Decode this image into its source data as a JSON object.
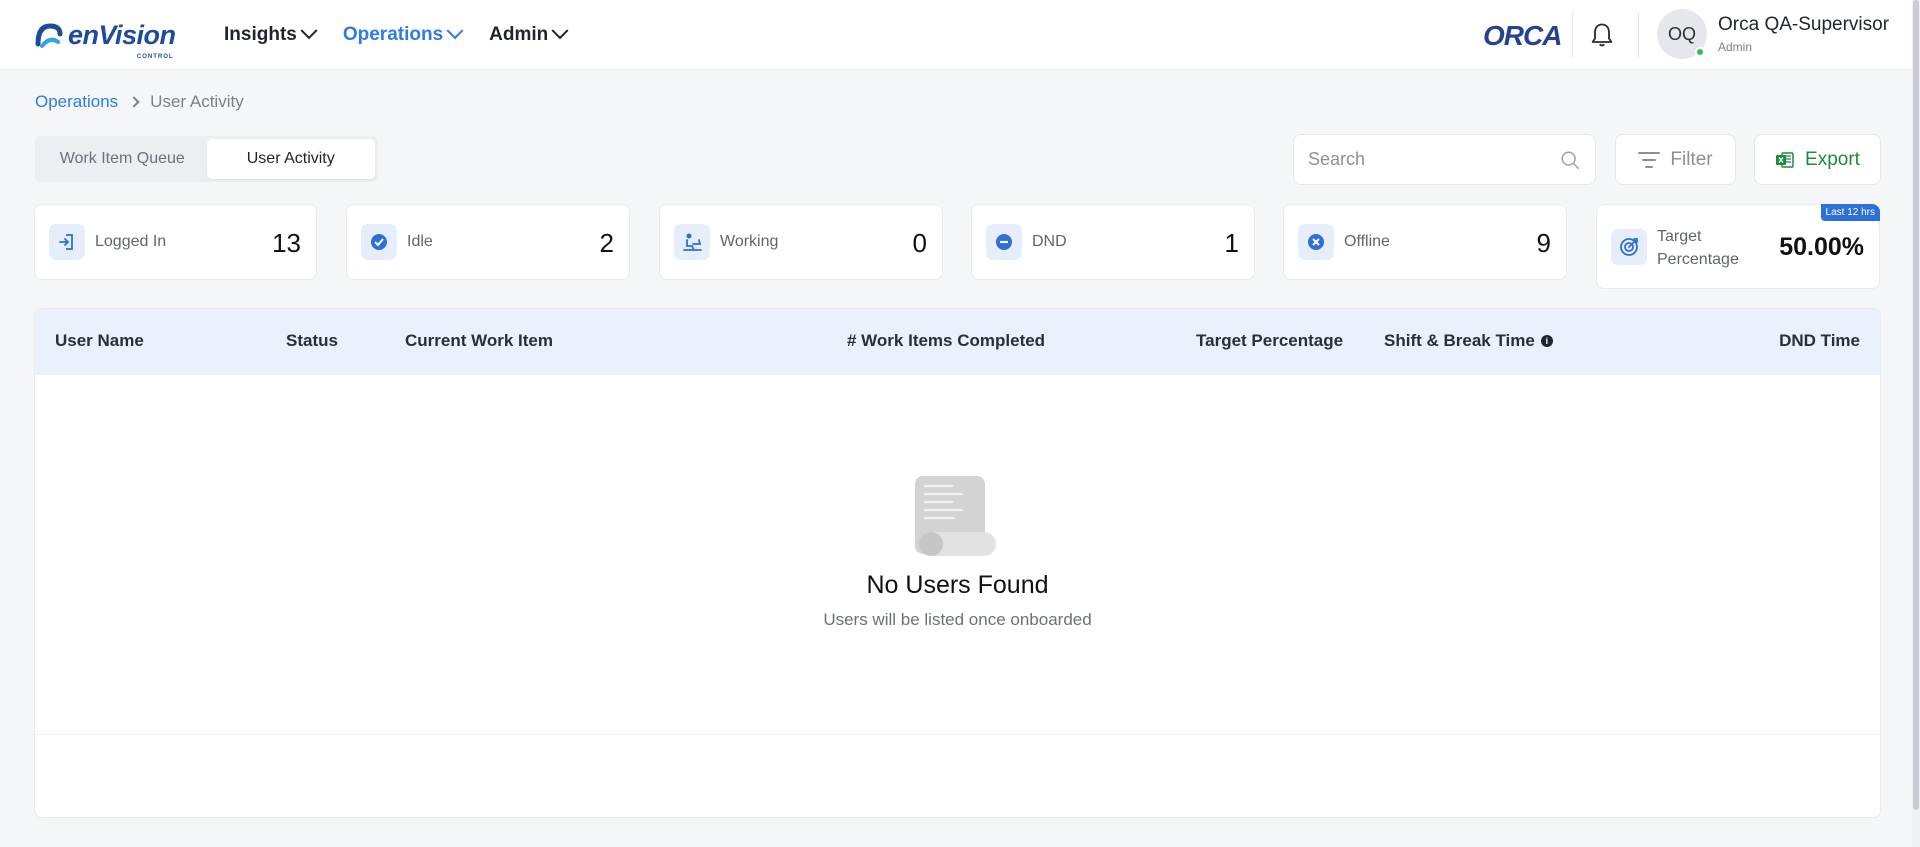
{
  "header": {
    "logo_text": "enVision",
    "logo_sub": "CONTROL",
    "nav": [
      {
        "label": "Insights",
        "active": false
      },
      {
        "label": "Operations",
        "active": true
      },
      {
        "label": "Admin",
        "active": false
      }
    ],
    "brand_right": "ORCA",
    "user": {
      "initials": "OQ",
      "name": "Orca QA-Supervisor",
      "role": "Admin",
      "online": true
    }
  },
  "breadcrumb": {
    "parent": "Operations",
    "current": "User Activity"
  },
  "tabs": [
    {
      "label": "Work Item Queue",
      "active": false
    },
    {
      "label": "User Activity",
      "active": true
    }
  ],
  "toolbar": {
    "search_placeholder": "Search",
    "filter_label": "Filter",
    "export_label": "Export"
  },
  "stats": [
    {
      "label": "Logged In",
      "value": "13",
      "icon": "login-icon"
    },
    {
      "label": "Idle",
      "value": "2",
      "icon": "check-circle-icon"
    },
    {
      "label": "Working",
      "value": "0",
      "icon": "working-icon"
    },
    {
      "label": "DND",
      "value": "1",
      "icon": "minus-circle-icon"
    },
    {
      "label": "Offline",
      "value": "9",
      "icon": "x-circle-icon"
    }
  ],
  "target": {
    "label": "Target Percentage",
    "value": "50.00%",
    "badge": "Last 12 hrs",
    "icon": "target-icon"
  },
  "table": {
    "columns": [
      "User Name",
      "Status",
      "Current Work Item",
      "# Work Items Completed",
      "Target Percentage",
      "Shift & Break Time",
      "DND Time"
    ],
    "info_glyph": "i",
    "empty_title": "No Users Found",
    "empty_subtitle": "Users will be listed once onboarded"
  },
  "colors": {
    "accent": "#2e7be6",
    "export": "#1e8a3c",
    "header_bg": "#eaf1fc"
  }
}
